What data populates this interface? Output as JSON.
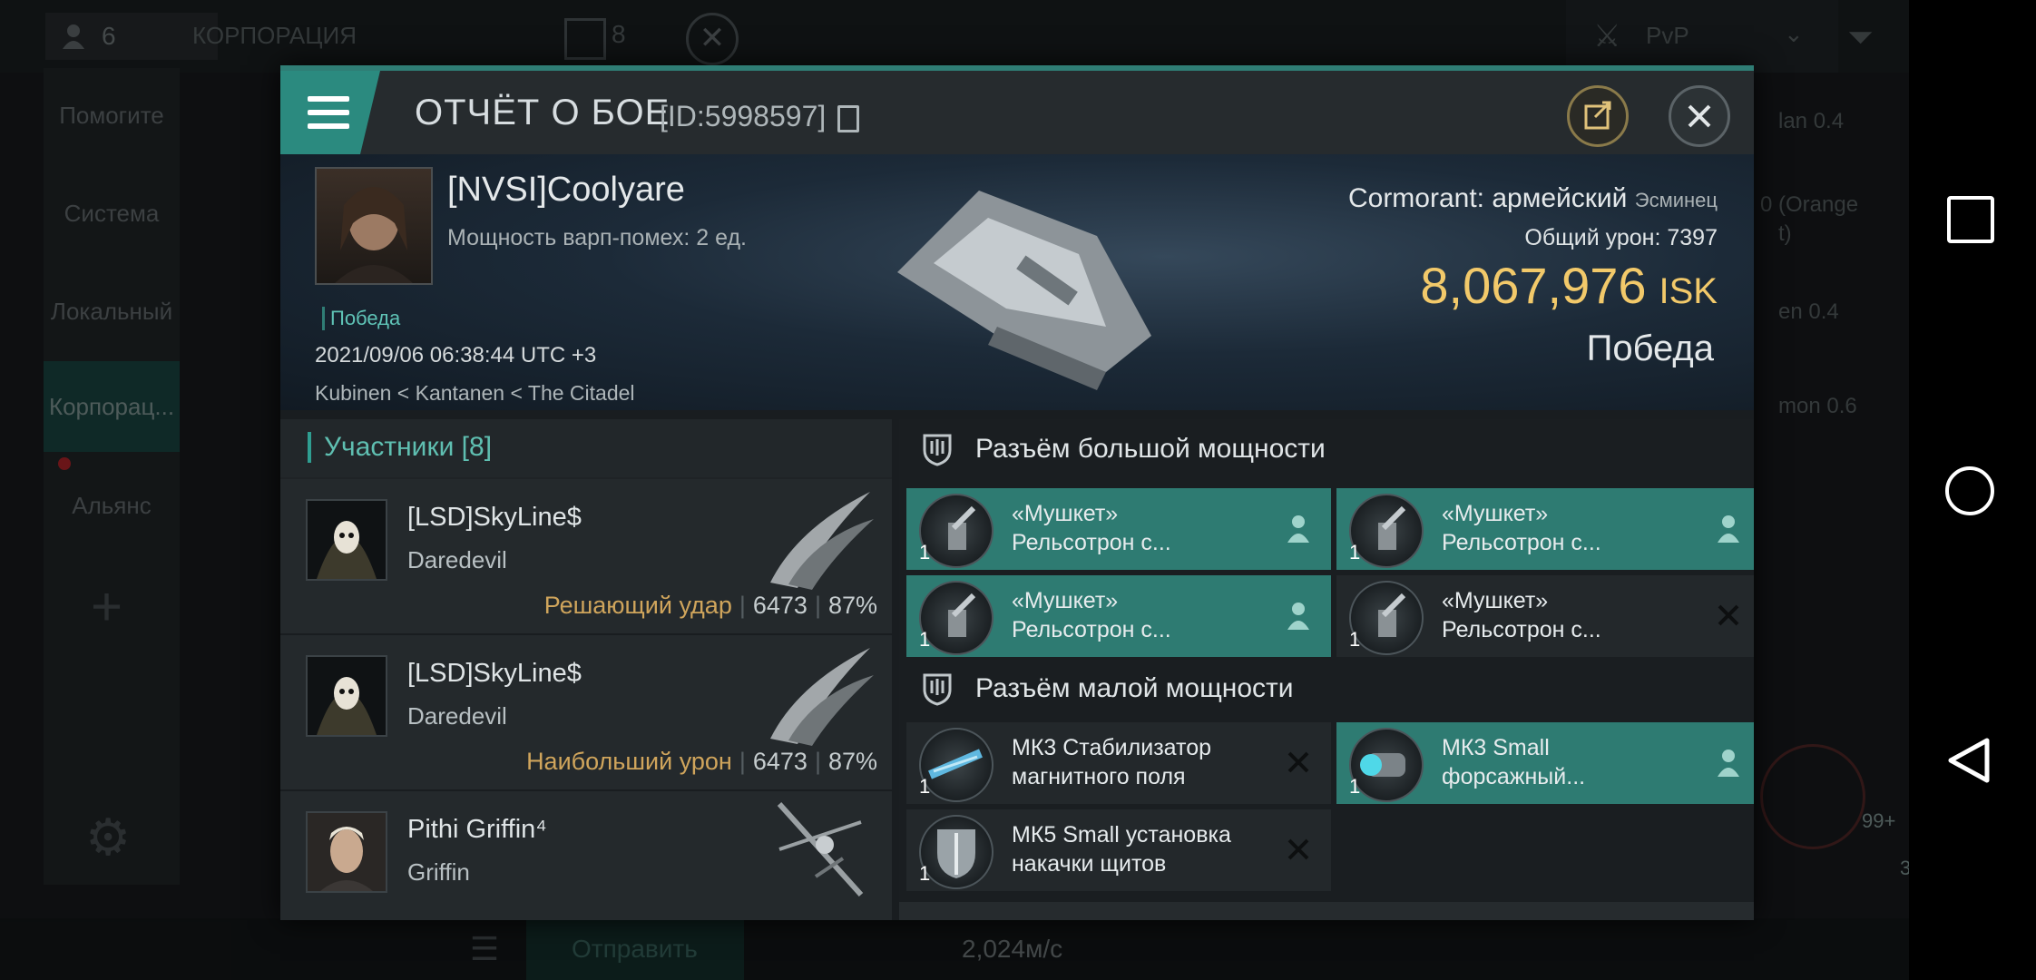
{
  "background": {
    "online_count": "6",
    "channel_title": "КОРПОРАЦИЯ",
    "channel_count": "8",
    "pvp_filter": "PvP",
    "sidebar": [
      "Помогите",
      "Система",
      "Локальный",
      "Корпорац...",
      "Альянс"
    ],
    "right_list": [
      "lan 0.4",
      "0 (Orange",
      "t)",
      "en 0.4",
      "mon 0.6"
    ],
    "speed": "2,024м/с",
    "send_label": "Отправить",
    "badge_99": "99+",
    "badge_3": "3",
    "badge_1": "1"
  },
  "report": {
    "title": "ОТЧЁТ О БОЕ",
    "id": "[ID:5998597]",
    "victim": {
      "name": "[NVSI]Coolyare",
      "warp": "Мощность варп-помех: 2 ед.",
      "tag": "Победа",
      "datetime": "2021/09/06 06:38:44 UTC +3",
      "location": "Kubinen < Kantanen < The Citadel"
    },
    "ship": {
      "name": "Cormorant: армейский",
      "class": "Эсминец",
      "damage_label": "Общий урон:",
      "damage_value": "7397",
      "isk_value": "8,067,976",
      "isk_unit": "ISK",
      "result": "Победа"
    },
    "participants": {
      "label": "Участники",
      "count": "[8]",
      "rows": [
        {
          "name": "[LSD]SkyLine$",
          "ship": "Daredevil",
          "tag": "Решающий удар",
          "damage": "6473",
          "percent": "87%"
        },
        {
          "name": "[LSD]SkyLine$",
          "ship": "Daredevil",
          "tag": "Наибольший урон",
          "damage": "6473",
          "percent": "87%"
        },
        {
          "name": "Pithi Griffin⁴",
          "ship": "Griffin",
          "tag": "",
          "damage": "",
          "percent": ""
        }
      ]
    },
    "high_slots": {
      "title": "Разъём большой мощности",
      "items": [
        {
          "line1": "«Мушкет»",
          "line2": "Рельсотрон с...",
          "qty": "1",
          "status": "pilot-icon"
        },
        {
          "line1": "«Мушкет»",
          "line2": "Рельсотрон с...",
          "qty": "1",
          "status": "pilot-icon"
        },
        {
          "line1": "«Мушкет»",
          "line2": "Рельсотрон с...",
          "qty": "1",
          "status": "pilot-icon"
        },
        {
          "line1": "«Мушкет»",
          "line2": "Рельсотрон с...",
          "qty": "1",
          "status": "destroyed-icon"
        }
      ]
    },
    "low_slots": {
      "title": "Разъём малой мощности",
      "items": [
        {
          "line1": "МК3 Стабилизатор",
          "line2": "магнитного поля",
          "qty": "1",
          "status": "destroyed-icon"
        },
        {
          "line1": "МК3 Small",
          "line2": "форсажный...",
          "qty": "1",
          "status": "pilot-icon"
        },
        {
          "line1": "МК5 Small установка",
          "line2": " накачки щитов",
          "qty": "1",
          "status": "destroyed-icon"
        }
      ]
    }
  },
  "colors": {
    "accent": "#2e7b72",
    "isk": "#f2c96a",
    "tag": "#d0a55c"
  }
}
